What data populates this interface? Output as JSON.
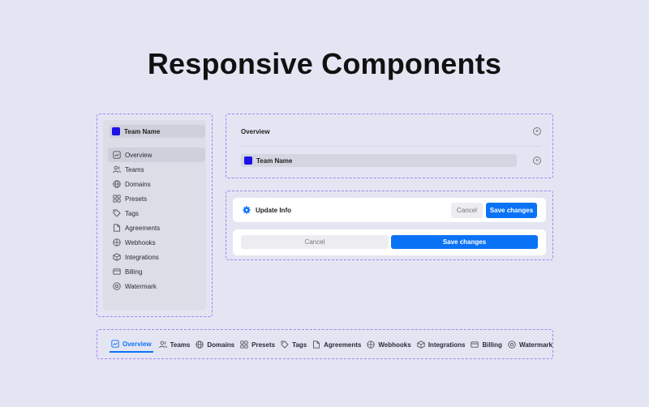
{
  "page": {
    "title": "Responsive Components"
  },
  "sidebar": {
    "team_name": "Team Name",
    "items": [
      {
        "label": "Overview",
        "icon": "overview-icon",
        "active": true
      },
      {
        "label": "Teams",
        "icon": "users-icon"
      },
      {
        "label": "Domains",
        "icon": "globe-icon"
      },
      {
        "label": "Presets",
        "icon": "grid-icon"
      },
      {
        "label": "Tags",
        "icon": "tag-icon"
      },
      {
        "label": "Agreements",
        "icon": "document-icon"
      },
      {
        "label": "Webhooks",
        "icon": "webhook-icon"
      },
      {
        "label": "Integrations",
        "icon": "box-icon"
      },
      {
        "label": "Billing",
        "icon": "credit-card-icon"
      },
      {
        "label": "Watermark",
        "icon": "watermark-icon"
      }
    ]
  },
  "overview_panel": {
    "label": "Overview",
    "team_name": "Team Name"
  },
  "update_panel": {
    "title": "Update Info",
    "cancel_label": "Cancel",
    "save_label": "Save changes"
  },
  "bottom_nav": {
    "items": [
      {
        "label": "Overview",
        "active": true
      },
      {
        "label": "Teams"
      },
      {
        "label": "Domains"
      },
      {
        "label": "Presets"
      },
      {
        "label": "Tags"
      },
      {
        "label": "Agreements"
      },
      {
        "label": "Webhooks"
      },
      {
        "label": "Integrations"
      },
      {
        "label": "Billing"
      },
      {
        "label": "Watermark"
      }
    ]
  },
  "colors": {
    "accent": "#0a73f5",
    "team_logo": "#1d12e8",
    "dashed_frame": "#9d86f0",
    "background": "#e4e5f3"
  }
}
